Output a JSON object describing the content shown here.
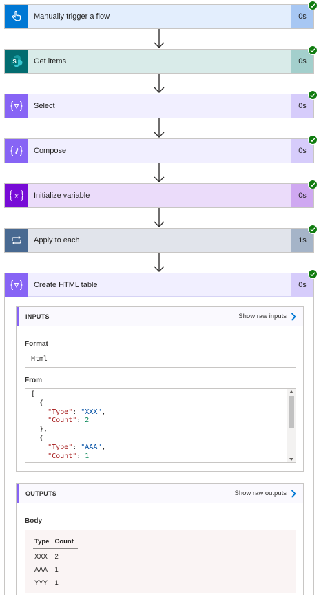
{
  "steps": [
    {
      "title": "Manually trigger a flow",
      "duration": "0s",
      "icon": "hand-touch-icon",
      "bg": "#e3eefd",
      "icon_bg": "#0078d4",
      "dur_bg": "#a7c7f3"
    },
    {
      "title": "Get items",
      "duration": "0s",
      "icon": "sharepoint-icon",
      "bg": "#d9ebe9",
      "icon_bg": "#036c70",
      "dur_bg": "#a3cfcc"
    },
    {
      "title": "Select",
      "duration": "0s",
      "icon": "data-operation-icon",
      "bg": "#f1efff",
      "icon_bg": "#8764f5",
      "dur_bg": "#d6ccfb"
    },
    {
      "title": "Compose",
      "duration": "0s",
      "icon": "data-operation-icon",
      "bg": "#f1efff",
      "icon_bg": "#8764f5",
      "dur_bg": "#d6ccfb"
    },
    {
      "title": "Initialize variable",
      "duration": "0s",
      "icon": "variable-icon",
      "bg": "#ebdcfa",
      "icon_bg": "#770bd6",
      "dur_bg": "#cfa8f1"
    },
    {
      "title": "Apply to each",
      "duration": "1s",
      "icon": "loop-icon",
      "bg": "#e1e4eb",
      "icon_bg": "#486991",
      "dur_bg": "#a5b4c8"
    }
  ],
  "expanded_step": {
    "title": "Create HTML table",
    "duration": "0s",
    "inputs": {
      "header": "INPUTS",
      "show_raw": "Show raw inputs",
      "format_label": "Format",
      "format_value": "Html",
      "from_label": "From",
      "from_lines": [
        "[",
        "  {",
        "    \"Type\": \"XXX\",",
        "    \"Count\": 2",
        "  },",
        "  {",
        "    \"Type\": \"AAA\",",
        "    \"Count\": 1"
      ]
    },
    "outputs": {
      "header": "OUTPUTS",
      "show_raw": "Show raw outputs",
      "body_label": "Body",
      "table_headers": [
        "Type",
        "Count"
      ],
      "table_rows": [
        [
          "XXX",
          "2"
        ],
        [
          "AAA",
          "1"
        ],
        [
          "YYY",
          "1"
        ]
      ]
    }
  },
  "colors": {
    "success": "#107c10",
    "link_chevron": "#0078d4"
  }
}
